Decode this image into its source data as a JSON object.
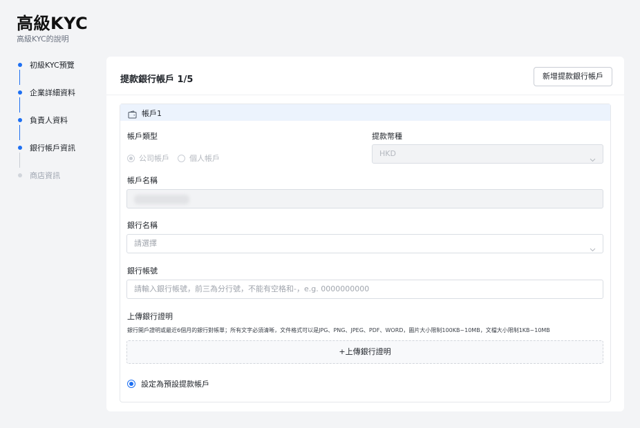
{
  "page": {
    "title": "高級KYC",
    "subtitle": "高級KYC的說明"
  },
  "steps": [
    {
      "label": "初級KYC預覽",
      "state": "done"
    },
    {
      "label": "企業詳細資料",
      "state": "done"
    },
    {
      "label": "負責人資料",
      "state": "done"
    },
    {
      "label": "銀行帳戶資訊",
      "state": "current"
    },
    {
      "label": "商店資訊",
      "state": "pending"
    }
  ],
  "card": {
    "title": "提款銀行帳戶 1/5",
    "add_button": "新增提款銀行帳戶"
  },
  "account": {
    "label": "帳戶1",
    "type_label": "帳戶類型",
    "type_options": [
      "公司帳戶",
      "個人帳戶"
    ],
    "type_selected": "公司帳戶",
    "currency_label": "提款幣種",
    "currency_value": "HKD",
    "name_label": "帳戶名稱",
    "bank_label": "銀行名稱",
    "bank_placeholder": "請選擇",
    "number_label": "銀行帳號",
    "number_placeholder": "請輸入銀行帳號，前三為分行號，不能有空格和-，e.g. 0000000000",
    "upload_label": "上傳銀行證明",
    "upload_hint": "銀行開戶證明或最近6個月的銀行對帳單；所有文字必須清晰，文件格式可以是JPG、PNG、JPEG、PDF、WORD，圖片大小限制100KB~10MB，文檔大小限制1KB~10MB",
    "upload_button": "+上傳銀行證明",
    "default_label": "設定為預設提款帳戶"
  },
  "colors": {
    "accent": "#1d6ff2",
    "page_bg": "#f3f4f6",
    "account_header_bg": "#ecf3fd"
  }
}
